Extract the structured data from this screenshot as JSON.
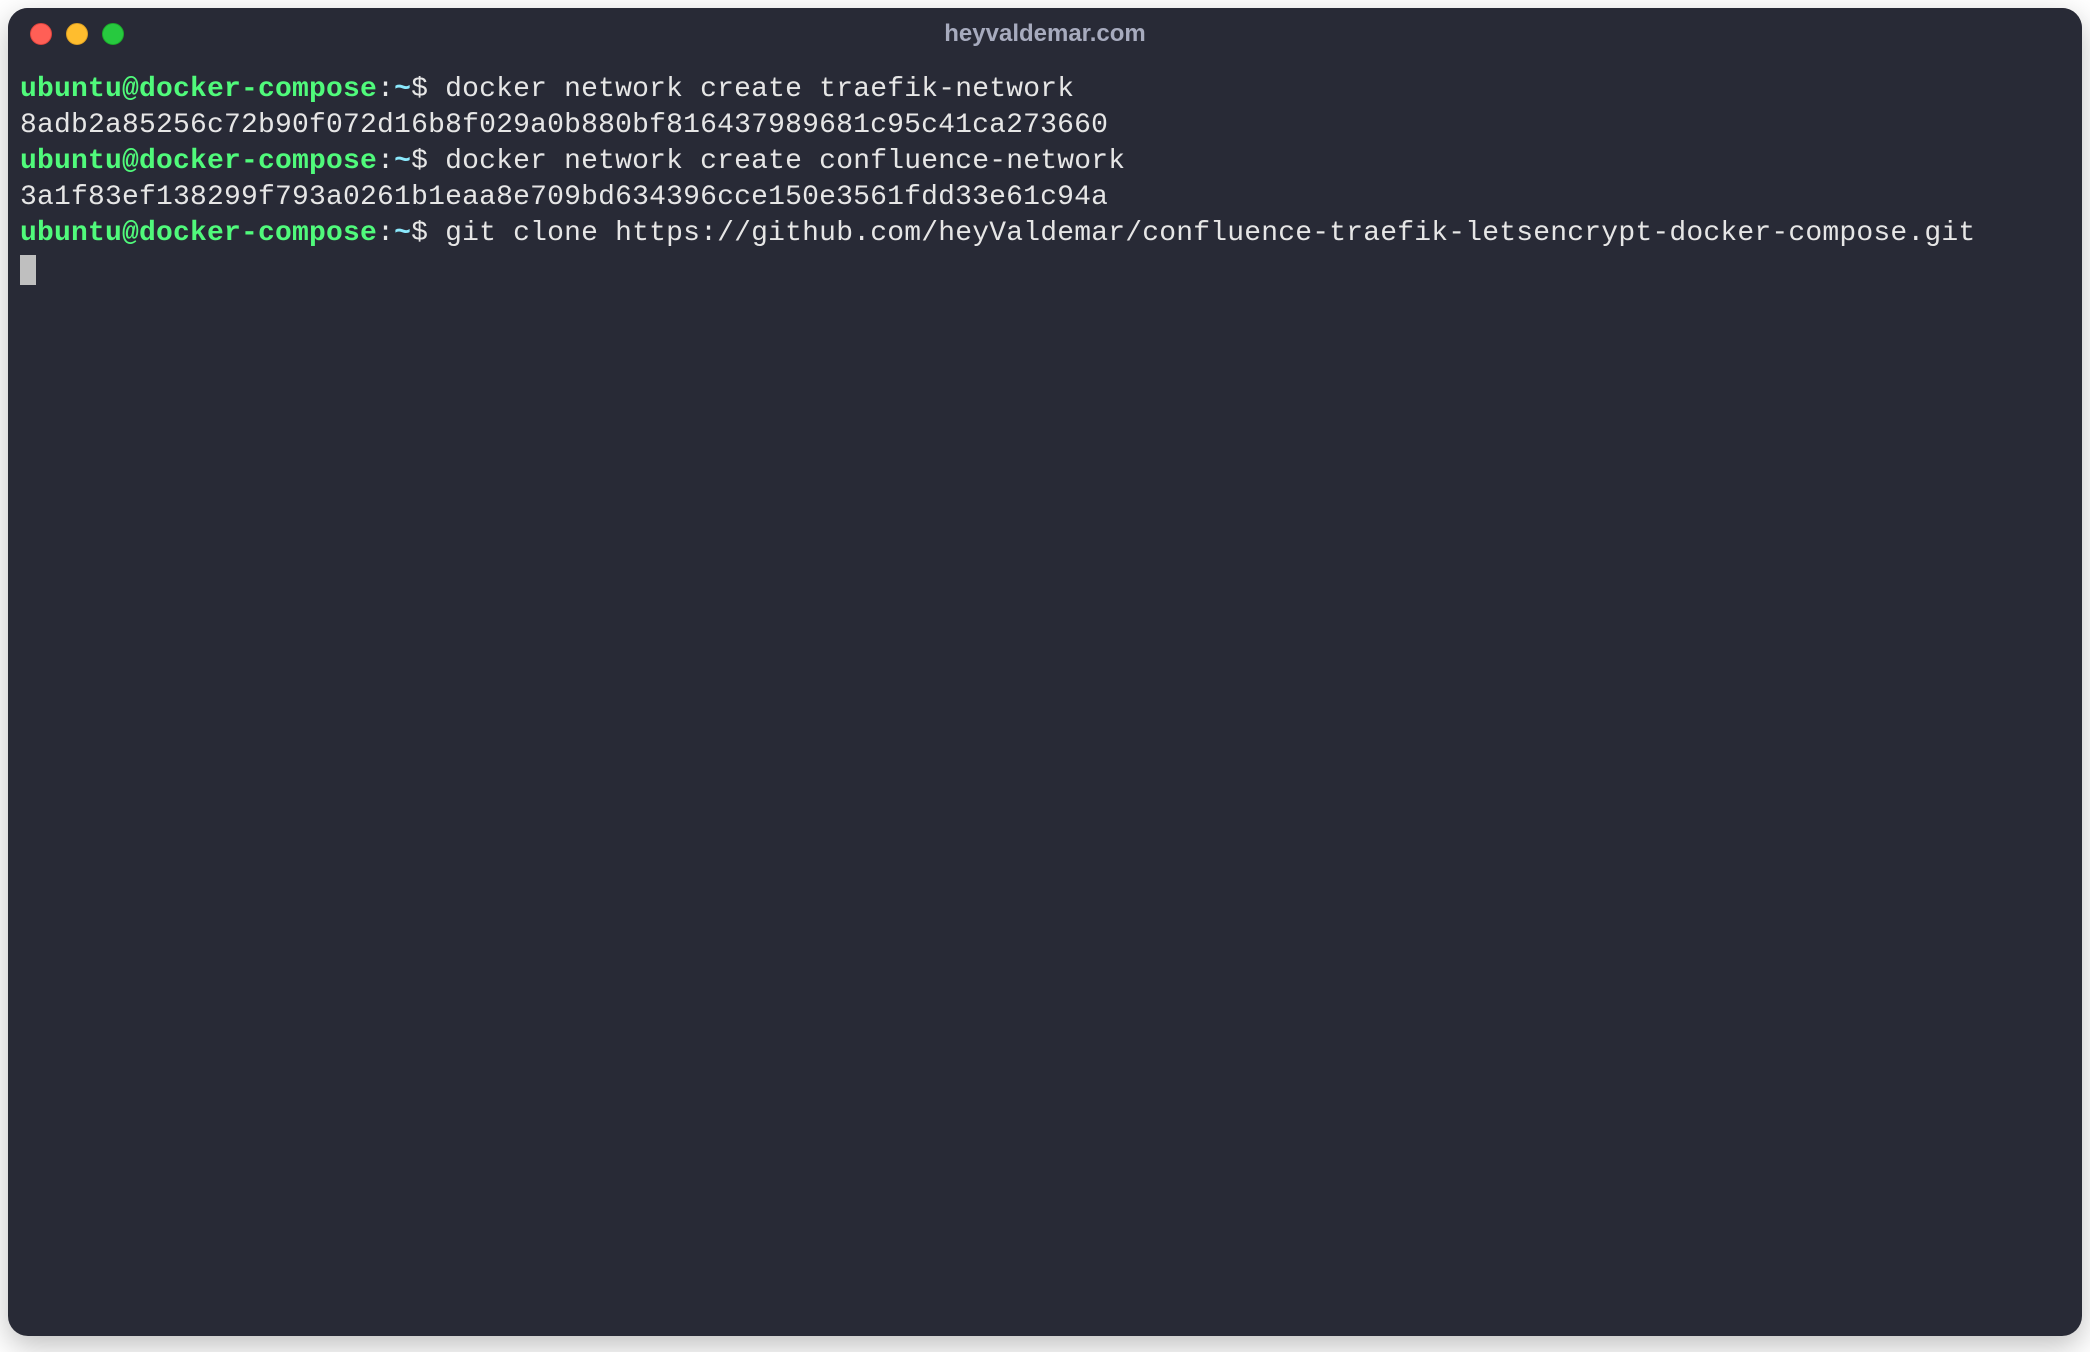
{
  "window": {
    "title": "heyvaldemar.com"
  },
  "prompt": {
    "user_host": "ubuntu@docker-compose",
    "sep": ":",
    "path": "~",
    "symbol": "$"
  },
  "lines": [
    {
      "type": "command",
      "text": "docker network create traefik-network"
    },
    {
      "type": "output",
      "text": "8adb2a85256c72b90f072d16b8f029a0b880bf816437989681c95c41ca273660"
    },
    {
      "type": "command",
      "text": "docker network create confluence-network"
    },
    {
      "type": "output",
      "text": "3a1f83ef138299f793a0261b1eaa8e709bd634396cce150e3561fdd33e61c94a"
    },
    {
      "type": "command",
      "text": "git clone https://github.com/heyValdemar/confluence-traefik-letsencrypt-docker-compose.git"
    }
  ],
  "colors": {
    "background": "#282a36",
    "prompt_user": "#50fa7b",
    "prompt_path": "#8be9fd",
    "text": "#e6e6e6"
  }
}
